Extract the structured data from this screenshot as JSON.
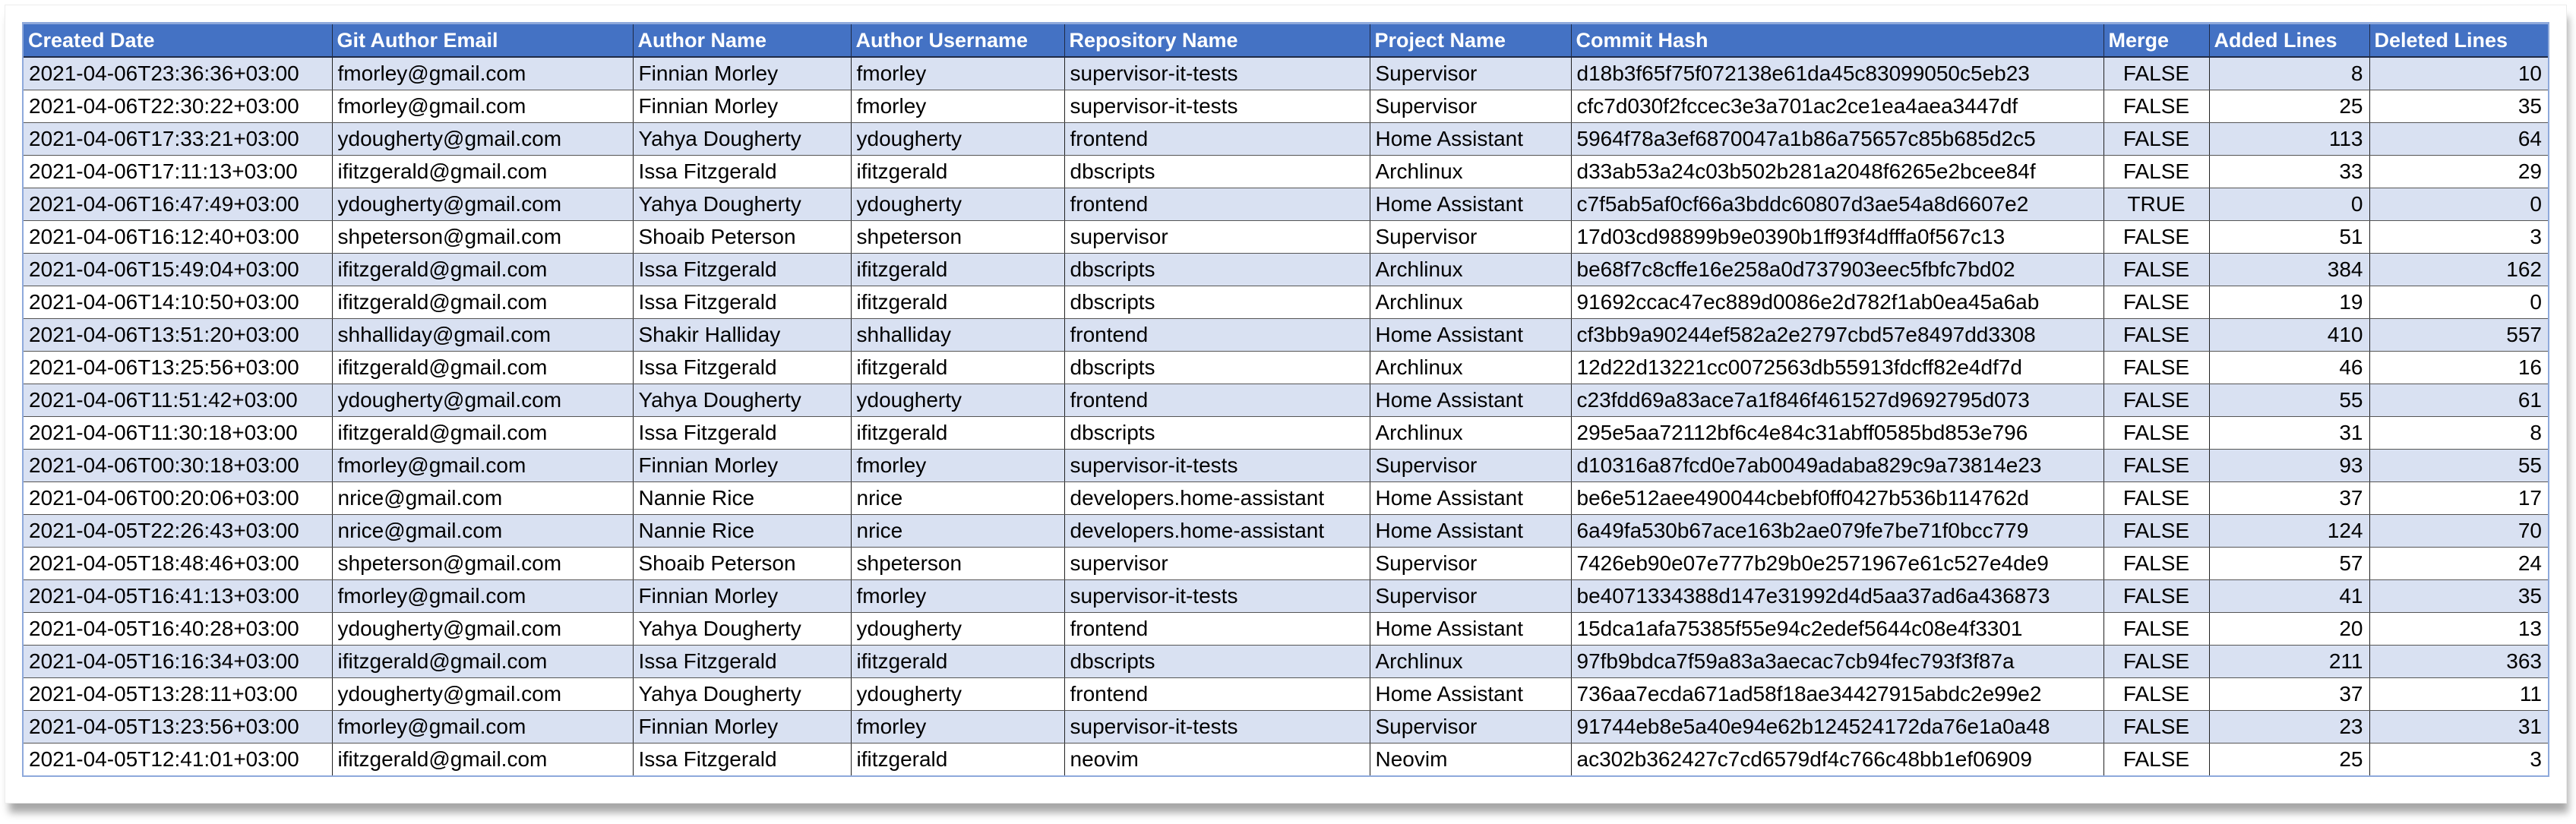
{
  "colors": {
    "header_bg": "#4472c4",
    "header_text": "#ffffff",
    "band_row_bg": "#d9e1f2",
    "plain_row_bg": "#ffffff",
    "table_border": "#8ea9db"
  },
  "table": {
    "headers": [
      "Created Date",
      "Git Author Email",
      "Author Name",
      "Author Username",
      "Repository Name",
      "Project Name",
      "Commit Hash",
      "Merge",
      "Added Lines",
      "Deleted Lines"
    ],
    "rows": [
      [
        "2021-04-06T23:36:36+03:00",
        "fmorley@gmail.com",
        "Finnian Morley",
        "fmorley",
        "supervisor-it-tests",
        "Supervisor",
        "d18b3f65f75f072138e61da45c83099050c5eb23",
        "FALSE",
        "8",
        "10"
      ],
      [
        "2021-04-06T22:30:22+03:00",
        "fmorley@gmail.com",
        "Finnian Morley",
        "fmorley",
        "supervisor-it-tests",
        "Supervisor",
        "cfc7d030f2fccec3e3a701ac2ce1ea4aea3447df",
        "FALSE",
        "25",
        "35"
      ],
      [
        "2021-04-06T17:33:21+03:00",
        "ydougherty@gmail.com",
        "Yahya Dougherty",
        "ydougherty",
        "frontend",
        "Home Assistant",
        "5964f78a3ef6870047a1b86a75657c85b685d2c5",
        "FALSE",
        "113",
        "64"
      ],
      [
        "2021-04-06T17:11:13+03:00",
        "ifitzgerald@gmail.com",
        "Issa Fitzgerald",
        "ifitzgerald",
        "dbscripts",
        "Archlinux",
        "d33ab53a24c03b502b281a2048f6265e2bcee84f",
        "FALSE",
        "33",
        "29"
      ],
      [
        "2021-04-06T16:47:49+03:00",
        "ydougherty@gmail.com",
        "Yahya Dougherty",
        "ydougherty",
        "frontend",
        "Home Assistant",
        "c7f5ab5af0cf66a3bddc60807d3ae54a8d6607e2",
        "TRUE",
        "0",
        "0"
      ],
      [
        "2021-04-06T16:12:40+03:00",
        "shpeterson@gmail.com",
        "Shoaib Peterson",
        "shpeterson",
        "supervisor",
        "Supervisor",
        "17d03cd98899b9e0390b1ff93f4dfffa0f567c13",
        "FALSE",
        "51",
        "3"
      ],
      [
        "2021-04-06T15:49:04+03:00",
        "ifitzgerald@gmail.com",
        "Issa Fitzgerald",
        "ifitzgerald",
        "dbscripts",
        "Archlinux",
        "be68f7c8cffe16e258a0d737903eec5fbfc7bd02",
        "FALSE",
        "384",
        "162"
      ],
      [
        "2021-04-06T14:10:50+03:00",
        "ifitzgerald@gmail.com",
        "Issa Fitzgerald",
        "ifitzgerald",
        "dbscripts",
        "Archlinux",
        "91692ccac47ec889d0086e2d782f1ab0ea45a6ab",
        "FALSE",
        "19",
        "0"
      ],
      [
        "2021-04-06T13:51:20+03:00",
        "shhalliday@gmail.com",
        "Shakir Halliday",
        "shhalliday",
        "frontend",
        "Home Assistant",
        "cf3bb9a90244ef582a2e2797cbd57e8497dd3308",
        "FALSE",
        "410",
        "557"
      ],
      [
        "2021-04-06T13:25:56+03:00",
        "ifitzgerald@gmail.com",
        "Issa Fitzgerald",
        "ifitzgerald",
        "dbscripts",
        "Archlinux",
        "12d22d13221cc0072563db55913fdcff82e4df7d",
        "FALSE",
        "46",
        "16"
      ],
      [
        "2021-04-06T11:51:42+03:00",
        "ydougherty@gmail.com",
        "Yahya Dougherty",
        "ydougherty",
        "frontend",
        "Home Assistant",
        "c23fdd69a83ace7a1f846f461527d9692795d073",
        "FALSE",
        "55",
        "61"
      ],
      [
        "2021-04-06T11:30:18+03:00",
        "ifitzgerald@gmail.com",
        "Issa Fitzgerald",
        "ifitzgerald",
        "dbscripts",
        "Archlinux",
        "295e5aa72112bf6c4e84c31abff0585bd853e796",
        "FALSE",
        "31",
        "8"
      ],
      [
        "2021-04-06T00:30:18+03:00",
        "fmorley@gmail.com",
        "Finnian Morley",
        "fmorley",
        "supervisor-it-tests",
        "Supervisor",
        "d10316a87fcd0e7ab0049adaba829c9a73814e23",
        "FALSE",
        "93",
        "55"
      ],
      [
        "2021-04-06T00:20:06+03:00",
        "nrice@gmail.com",
        "Nannie Rice",
        "nrice",
        "developers.home-assistant",
        "Home Assistant",
        "be6e512aee490044cbebf0ff0427b536b114762d",
        "FALSE",
        "37",
        "17"
      ],
      [
        "2021-04-05T22:26:43+03:00",
        "nrice@gmail.com",
        "Nannie Rice",
        "nrice",
        "developers.home-assistant",
        "Home Assistant",
        "6a49fa530b67ace163b2ae079fe7be71f0bcc779",
        "FALSE",
        "124",
        "70"
      ],
      [
        "2021-04-05T18:48:46+03:00",
        "shpeterson@gmail.com",
        "Shoaib Peterson",
        "shpeterson",
        "supervisor",
        "Supervisor",
        "7426eb90e07e777b29b0e2571967e61c527e4de9",
        "FALSE",
        "57",
        "24"
      ],
      [
        "2021-04-05T16:41:13+03:00",
        "fmorley@gmail.com",
        "Finnian Morley",
        "fmorley",
        "supervisor-it-tests",
        "Supervisor",
        "be4071334388d147e31992d4d5aa37ad6a436873",
        "FALSE",
        "41",
        "35"
      ],
      [
        "2021-04-05T16:40:28+03:00",
        "ydougherty@gmail.com",
        "Yahya Dougherty",
        "ydougherty",
        "frontend",
        "Home Assistant",
        "15dca1afa75385f55e94c2edef5644c08e4f3301",
        "FALSE",
        "20",
        "13"
      ],
      [
        "2021-04-05T16:16:34+03:00",
        "ifitzgerald@gmail.com",
        "Issa Fitzgerald",
        "ifitzgerald",
        "dbscripts",
        "Archlinux",
        "97fb9bdca7f59a83a3aecac7cb94fec793f3f87a",
        "FALSE",
        "211",
        "363"
      ],
      [
        "2021-04-05T13:28:11+03:00",
        "ydougherty@gmail.com",
        "Yahya Dougherty",
        "ydougherty",
        "frontend",
        "Home Assistant",
        "736aa7ecda671ad58f18ae34427915abdc2e99e2",
        "FALSE",
        "37",
        "11"
      ],
      [
        "2021-04-05T13:23:56+03:00",
        "fmorley@gmail.com",
        "Finnian Morley",
        "fmorley",
        "supervisor-it-tests",
        "Supervisor",
        "91744eb8e5a40e94e62b124524172da76e1a0a48",
        "FALSE",
        "23",
        "31"
      ],
      [
        "2021-04-05T12:41:01+03:00",
        "ifitzgerald@gmail.com",
        "Issa Fitzgerald",
        "ifitzgerald",
        "neovim",
        "Neovim",
        "ac302b362427c7cd6579df4c766c48bb1ef06909",
        "FALSE",
        "25",
        "3"
      ]
    ]
  }
}
